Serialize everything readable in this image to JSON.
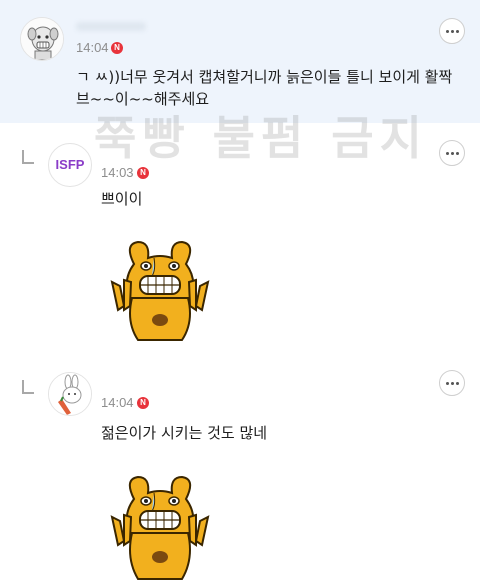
{
  "comments": [
    {
      "time": "14:04",
      "badge": "N",
      "text_line1": "ㄱ ㅆ))너무 웃겨서 캡쳐할거니까 늙은이들 틀니 보이게 활짝",
      "text_line2": "브~~이~~해주세요",
      "avatar_icon": "dog-avatar-icon",
      "more_icon": "more-options-icon"
    },
    {
      "time": "14:03",
      "badge": "N",
      "avatar_label": "ISFP",
      "text": "쁘이이",
      "sticker_icon": "laughing-bear-sticker"
    },
    {
      "time": "14:04",
      "badge": "N",
      "text": "젊은이가 시키는 것도 많네",
      "avatar_icon": "rabbit-avatar-icon",
      "sticker_icon": "laughing-bear-sticker"
    }
  ],
  "watermark": "쭉빵 불펌 금지",
  "colors": {
    "highlight_bg": "#eef4fc",
    "badge_red": "#e8333b",
    "isfp_purple": "#8a3cc8",
    "bear_yellow": "#f2b01e"
  }
}
